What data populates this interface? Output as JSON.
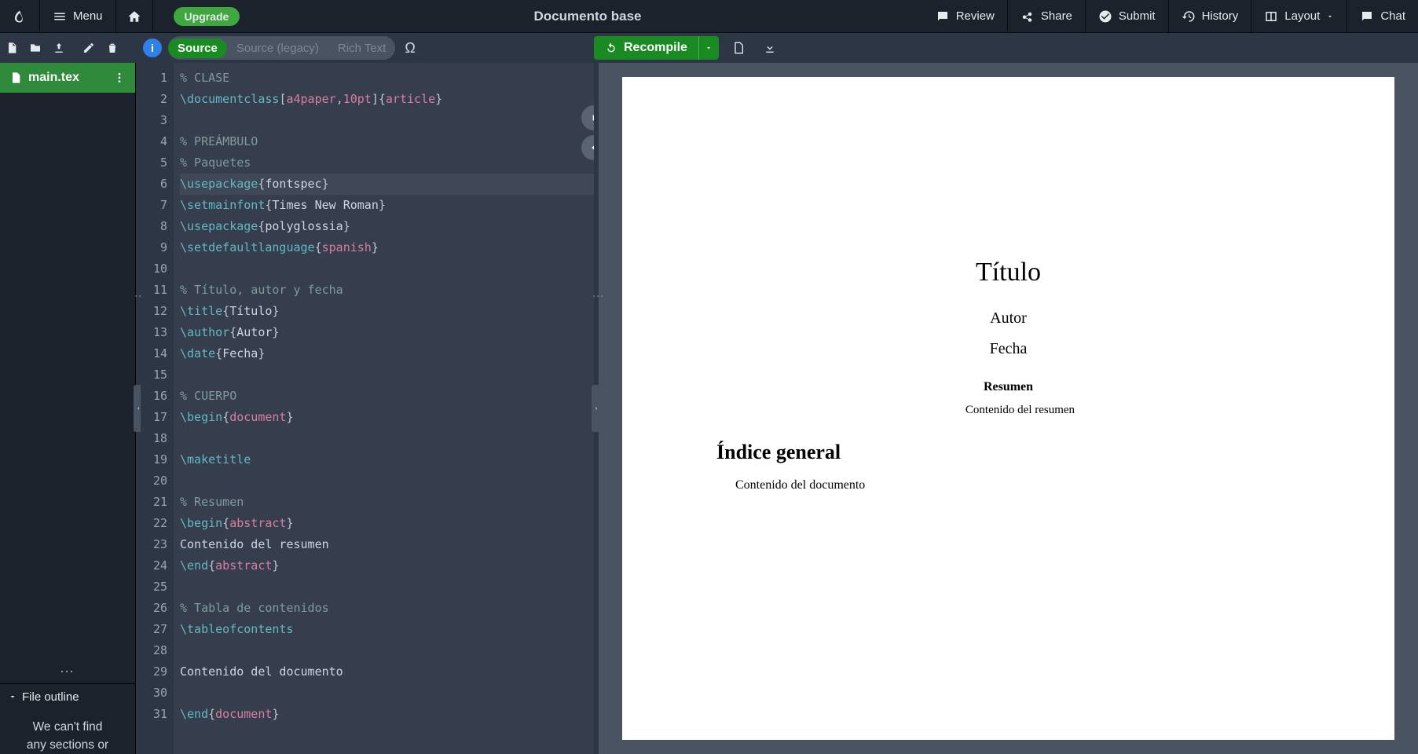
{
  "topnav": {
    "menu": "Menu",
    "upgrade": "Upgrade",
    "title": "Documento base",
    "review": "Review",
    "share": "Share",
    "submit": "Submit",
    "history": "History",
    "layout": "Layout",
    "chat": "Chat"
  },
  "toolbar": {
    "info": "i",
    "views": [
      "Source",
      "Source (legacy)",
      "Rich Text"
    ],
    "active_view": 0,
    "omega": "Ω",
    "recompile": "Recompile"
  },
  "filetree": {
    "active_file": "main.tex",
    "outline_header": "File outline",
    "outline_message_l1": "We can't find",
    "outline_message_l2": "any sections or"
  },
  "editor": {
    "lines": [
      {
        "n": 1,
        "tokens": [
          {
            "t": "% CLASE",
            "c": "comment"
          }
        ]
      },
      {
        "n": 2,
        "tokens": [
          {
            "t": "\\documentclass",
            "c": "cmd"
          },
          {
            "t": "[",
            "c": "brace"
          },
          {
            "t": "a4paper",
            "c": "arg"
          },
          {
            "t": ",",
            "c": "brace"
          },
          {
            "t": "10pt",
            "c": "arg"
          },
          {
            "t": "]{",
            "c": "brace"
          },
          {
            "t": "article",
            "c": "arg"
          },
          {
            "t": "}",
            "c": "brace"
          }
        ]
      },
      {
        "n": 3,
        "tokens": []
      },
      {
        "n": 4,
        "tokens": [
          {
            "t": "% PREÁMBULO",
            "c": "comment"
          }
        ]
      },
      {
        "n": 5,
        "tokens": [
          {
            "t": "% Paquetes",
            "c": "comment"
          }
        ]
      },
      {
        "n": 6,
        "hl": true,
        "tokens": [
          {
            "t": "\\usepackage",
            "c": "cmd"
          },
          {
            "t": "{",
            "c": "brace"
          },
          {
            "t": "fontspec",
            "c": "txt"
          },
          {
            "t": "}",
            "c": "brace"
          }
        ]
      },
      {
        "n": 7,
        "tokens": [
          {
            "t": "\\setmainfont",
            "c": "cmd"
          },
          {
            "t": "{",
            "c": "brace"
          },
          {
            "t": "Times New Roman",
            "c": "txt"
          },
          {
            "t": "}",
            "c": "brace"
          }
        ]
      },
      {
        "n": 8,
        "tokens": [
          {
            "t": "\\usepackage",
            "c": "cmd"
          },
          {
            "t": "{",
            "c": "brace"
          },
          {
            "t": "polyglossia",
            "c": "txt"
          },
          {
            "t": "}",
            "c": "brace"
          }
        ]
      },
      {
        "n": 9,
        "tokens": [
          {
            "t": "\\setdefaultlanguage",
            "c": "cmd"
          },
          {
            "t": "{",
            "c": "brace"
          },
          {
            "t": "spanish",
            "c": "arg"
          },
          {
            "t": "}",
            "c": "brace"
          }
        ]
      },
      {
        "n": 10,
        "tokens": []
      },
      {
        "n": 11,
        "tokens": [
          {
            "t": "% Título, autor y fecha",
            "c": "comment"
          }
        ]
      },
      {
        "n": 12,
        "tokens": [
          {
            "t": "\\title",
            "c": "cmd"
          },
          {
            "t": "{",
            "c": "brace"
          },
          {
            "t": "Título",
            "c": "txt"
          },
          {
            "t": "}",
            "c": "brace"
          }
        ]
      },
      {
        "n": 13,
        "tokens": [
          {
            "t": "\\author",
            "c": "cmd"
          },
          {
            "t": "{",
            "c": "brace"
          },
          {
            "t": "Autor",
            "c": "txt"
          },
          {
            "t": "}",
            "c": "brace"
          }
        ]
      },
      {
        "n": 14,
        "tokens": [
          {
            "t": "\\date",
            "c": "cmd"
          },
          {
            "t": "{",
            "c": "brace"
          },
          {
            "t": "Fecha",
            "c": "txt"
          },
          {
            "t": "}",
            "c": "brace"
          }
        ]
      },
      {
        "n": 15,
        "tokens": []
      },
      {
        "n": 16,
        "tokens": [
          {
            "t": "% CUERPO",
            "c": "comment"
          }
        ]
      },
      {
        "n": 17,
        "tokens": [
          {
            "t": "\\begin",
            "c": "cmd"
          },
          {
            "t": "{",
            "c": "brace"
          },
          {
            "t": "document",
            "c": "arg"
          },
          {
            "t": "}",
            "c": "brace"
          }
        ]
      },
      {
        "n": 18,
        "tokens": []
      },
      {
        "n": 19,
        "tokens": [
          {
            "t": "\\maketitle",
            "c": "cmd"
          }
        ]
      },
      {
        "n": 20,
        "tokens": []
      },
      {
        "n": 21,
        "tokens": [
          {
            "t": "% Resumen",
            "c": "comment"
          }
        ]
      },
      {
        "n": 22,
        "tokens": [
          {
            "t": "\\begin",
            "c": "cmd"
          },
          {
            "t": "{",
            "c": "brace"
          },
          {
            "t": "abstract",
            "c": "arg"
          },
          {
            "t": "}",
            "c": "brace"
          }
        ]
      },
      {
        "n": 23,
        "tokens": [
          {
            "t": "Contenido del resumen",
            "c": "txt"
          }
        ]
      },
      {
        "n": 24,
        "tokens": [
          {
            "t": "\\end",
            "c": "cmd"
          },
          {
            "t": "{",
            "c": "brace"
          },
          {
            "t": "abstract",
            "c": "arg"
          },
          {
            "t": "}",
            "c": "brace"
          }
        ]
      },
      {
        "n": 25,
        "tokens": []
      },
      {
        "n": 26,
        "tokens": [
          {
            "t": "% Tabla de contenidos",
            "c": "comment"
          }
        ]
      },
      {
        "n": 27,
        "tokens": [
          {
            "t": "\\tableofcontents",
            "c": "cmd"
          }
        ]
      },
      {
        "n": 28,
        "tokens": []
      },
      {
        "n": 29,
        "tokens": [
          {
            "t": "Contenido del documento",
            "c": "txt"
          }
        ]
      },
      {
        "n": 30,
        "tokens": []
      },
      {
        "n": 31,
        "tokens": [
          {
            "t": "\\end",
            "c": "cmd"
          },
          {
            "t": "{",
            "c": "brace"
          },
          {
            "t": "document",
            "c": "arg"
          },
          {
            "t": "}",
            "c": "brace"
          }
        ]
      }
    ]
  },
  "pdf": {
    "title": "Título",
    "author": "Autor",
    "date": "Fecha",
    "abstract_header": "Resumen",
    "abstract_body": "Contenido del resumen",
    "toc_header": "Índice general",
    "body": "Contenido del documento"
  }
}
